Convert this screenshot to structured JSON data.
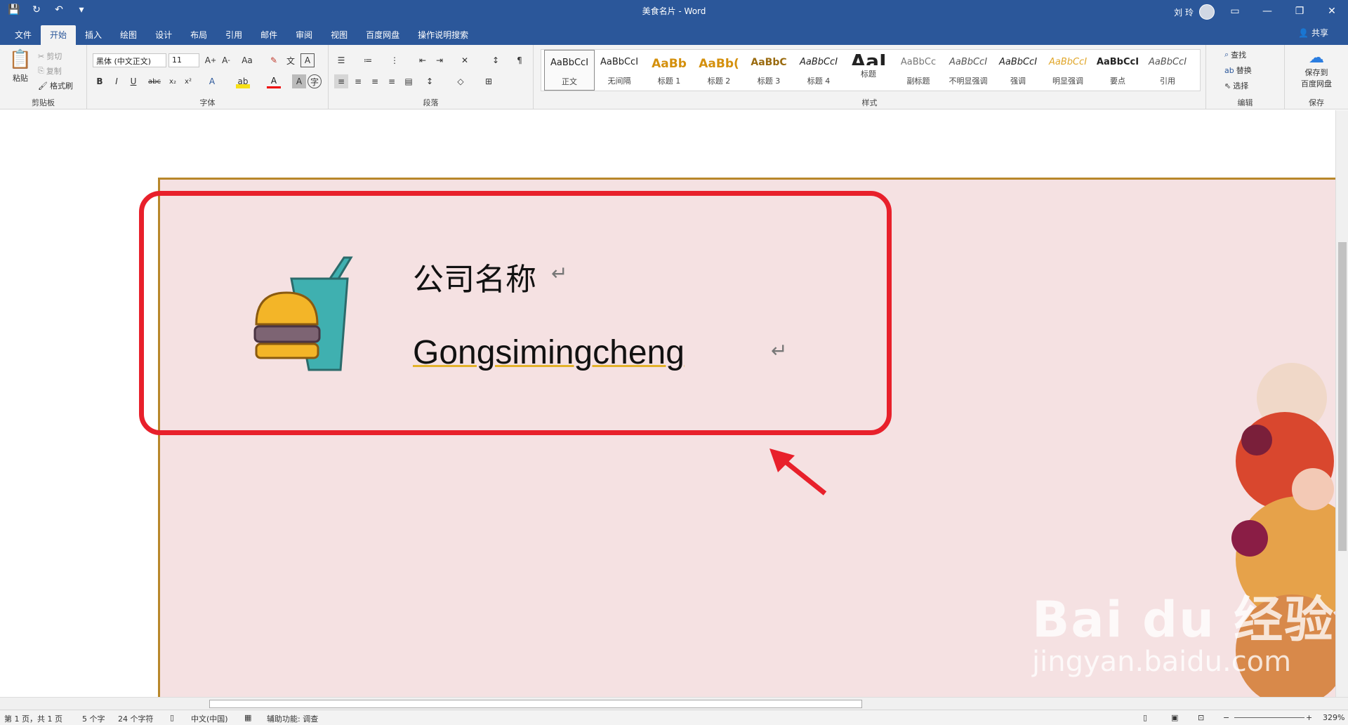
{
  "titlebar": {
    "title": "美食名片  -  Word",
    "user_name": "刘 玲"
  },
  "tabs": [
    "文件",
    "开始",
    "插入",
    "绘图",
    "设计",
    "布局",
    "引用",
    "邮件",
    "审阅",
    "视图",
    "百度网盘",
    "操作说明搜索"
  ],
  "active_tab": "开始",
  "share_label": "共享",
  "ribbon": {
    "clipboard": {
      "paste": "粘贴",
      "cut": "剪切",
      "copy": "复制",
      "format_painter": "格式刷",
      "label": "剪贴板"
    },
    "font": {
      "name": "黑体 (中文正文)",
      "size": "11",
      "label": "字体"
    },
    "paragraph": {
      "label": "段落"
    },
    "styles": {
      "label": "样式",
      "items": [
        {
          "preview": "AaBbCcI",
          "name": "正文"
        },
        {
          "preview": "AaBbCcI",
          "name": "无间隔"
        },
        {
          "preview": "AaBb",
          "name": "标题 1"
        },
        {
          "preview": "AaBb(",
          "name": "标题 2"
        },
        {
          "preview": "AaBbC",
          "name": "标题 3"
        },
        {
          "preview": "AaBbCcI",
          "name": "标题 4"
        },
        {
          "preview": "AaI",
          "name": "标题"
        },
        {
          "preview": "AaBbCc",
          "name": "副标题"
        },
        {
          "preview": "AaBbCcI",
          "name": "不明显强调"
        },
        {
          "preview": "AaBbCcI",
          "name": "强调"
        },
        {
          "preview": "AaBbCcI",
          "name": "明显强调"
        },
        {
          "preview": "AaBbCcI",
          "name": "要点"
        },
        {
          "preview": "AaBbCcI",
          "name": "引用"
        }
      ]
    },
    "editing": {
      "find": "查找",
      "replace": "替换",
      "select": "选择",
      "label": "编辑"
    },
    "save": {
      "line1": "保存到",
      "line2": "百度网盘",
      "label": "保存"
    }
  },
  "document": {
    "company_name": "公司名称",
    "company_pinyin": "Gongsimingcheng",
    "para_mark": "↵"
  },
  "watermark": {
    "line1": "Bai du 经验",
    "line2": "jingyan.baidu.com"
  },
  "status": {
    "page": "第 1 页，共 1 页",
    "chars": "5 个字",
    "char_count": "24 个字符",
    "lang": "中文(中国)",
    "accessibility": "辅助功能: 调查",
    "zoom": "329%"
  },
  "colors": {
    "brand": "#2b579a",
    "page_bg": "#f5e1e2",
    "border": "#b8872a",
    "highlight": "#e8202b"
  }
}
